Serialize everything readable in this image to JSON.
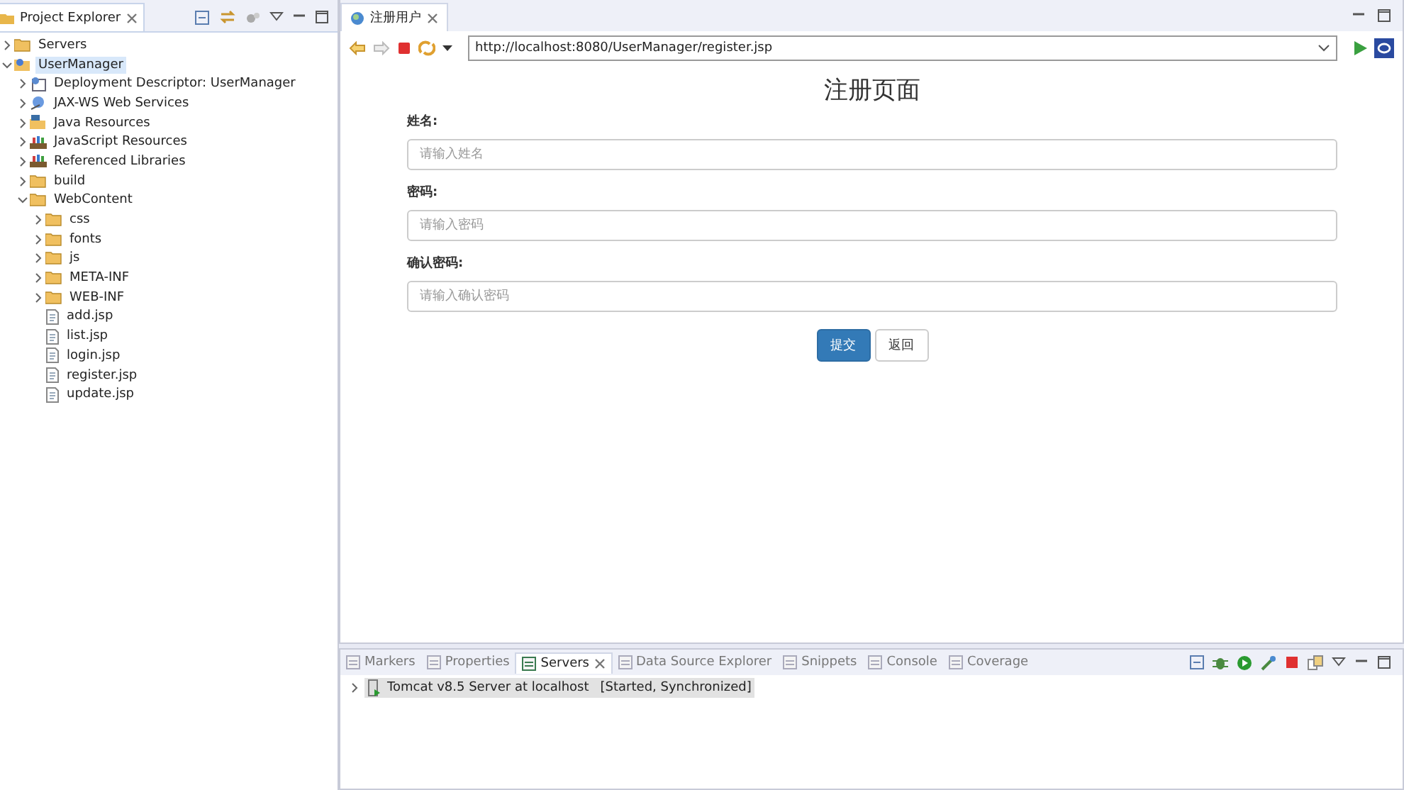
{
  "explorer": {
    "title": "Project Explorer",
    "tree": [
      {
        "label": "Servers",
        "kind": "folder",
        "expanded": false,
        "selected": false
      },
      {
        "label": "UserManager",
        "kind": "project",
        "expanded": true,
        "selected": true,
        "children": [
          {
            "label": "Deployment Descriptor: UserManager",
            "kind": "descriptor",
            "expanded": false,
            "selected": false
          },
          {
            "label": "JAX-WS Web Services",
            "kind": "webservice",
            "expanded": false,
            "selected": false
          },
          {
            "label": "Java Resources",
            "kind": "javares",
            "expanded": false,
            "selected": false
          },
          {
            "label": "JavaScript Resources",
            "kind": "library",
            "expanded": false,
            "selected": false
          },
          {
            "label": "Referenced Libraries",
            "kind": "library",
            "expanded": false,
            "selected": false
          },
          {
            "label": "build",
            "kind": "folder",
            "expanded": false,
            "selected": false
          },
          {
            "label": "WebContent",
            "kind": "folder",
            "expanded": true,
            "selected": false,
            "children": [
              {
                "label": "css",
                "kind": "folder",
                "expanded": false,
                "selected": false
              },
              {
                "label": "fonts",
                "kind": "folder",
                "expanded": false,
                "selected": false
              },
              {
                "label": "js",
                "kind": "folder",
                "expanded": false,
                "selected": false
              },
              {
                "label": "META-INF",
                "kind": "folder",
                "expanded": false,
                "selected": false
              },
              {
                "label": "WEB-INF",
                "kind": "folder",
                "expanded": false,
                "selected": false
              },
              {
                "label": "add.jsp",
                "kind": "file",
                "selected": false
              },
              {
                "label": "list.jsp",
                "kind": "file",
                "selected": false
              },
              {
                "label": "login.jsp",
                "kind": "file",
                "selected": false
              },
              {
                "label": "register.jsp",
                "kind": "file",
                "selected": false
              },
              {
                "label": "update.jsp",
                "kind": "file",
                "selected": false
              }
            ]
          }
        ]
      }
    ]
  },
  "editor": {
    "tab": "注册用户",
    "url": "http://localhost:8080/UserManager/register.jsp",
    "page": {
      "title": "注册页面",
      "fields": [
        {
          "label": "姓名:",
          "placeholder": "请输入姓名"
        },
        {
          "label": "密码:",
          "placeholder": "请输入密码"
        },
        {
          "label": "确认密码:",
          "placeholder": "请输入确认密码"
        }
      ],
      "buttons": [
        {
          "label": "提交",
          "kind": "primary"
        },
        {
          "label": "返回",
          "kind": "default"
        }
      ]
    }
  },
  "bottom": {
    "tabs": [
      {
        "label": "Markers",
        "selected": false
      },
      {
        "label": "Properties",
        "selected": false
      },
      {
        "label": "Servers",
        "selected": true
      },
      {
        "label": "Data Source Explorer",
        "selected": false
      },
      {
        "label": "Snippets",
        "selected": false
      },
      {
        "label": "Console",
        "selected": false
      },
      {
        "label": "Coverage",
        "selected": false
      }
    ],
    "servers": [
      {
        "name": "Tomcat v8.5 Server at localhost",
        "status": "[Started, Synchronized]",
        "expanded": false,
        "selected": true
      }
    ]
  }
}
